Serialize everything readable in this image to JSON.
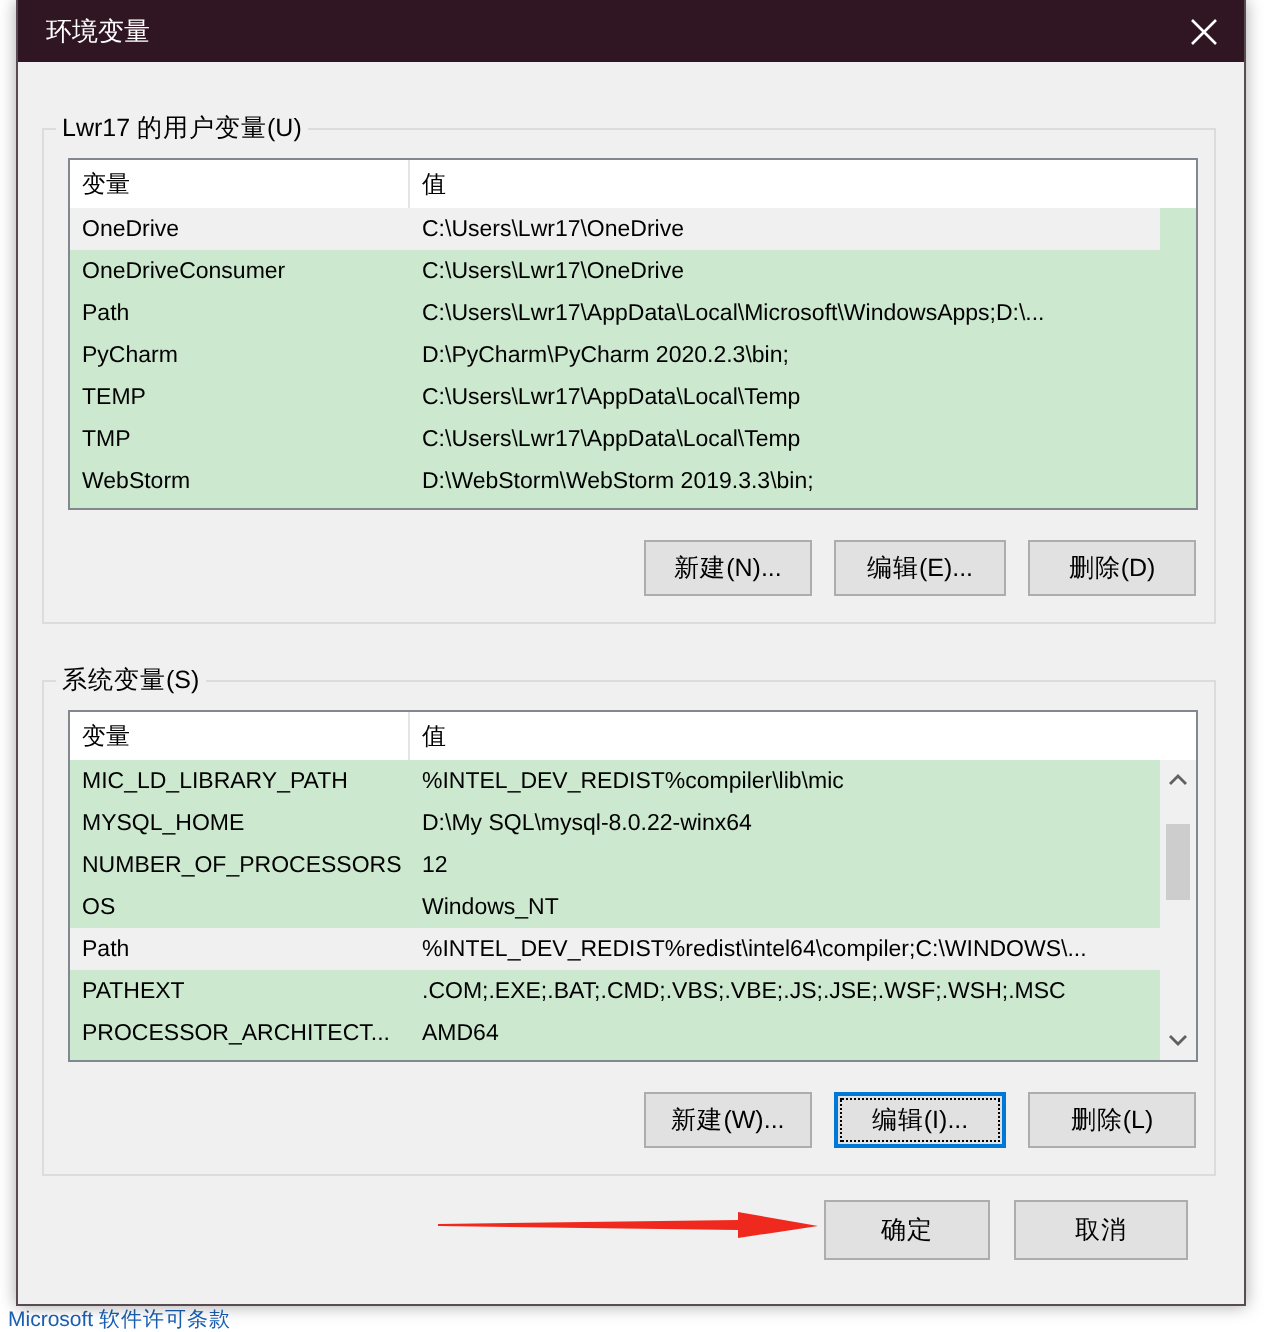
{
  "window": {
    "title": "环境变量"
  },
  "background": {
    "link": "Microsoft 软件许可条款"
  },
  "user_variables": {
    "title": "Lwr17 的用户变量(U)",
    "columns": [
      "变量",
      "值"
    ],
    "rows": [
      {
        "name": "OneDrive",
        "value": "C:\\Users\\Lwr17\\OneDrive",
        "selected": true
      },
      {
        "name": "OneDriveConsumer",
        "value": "C:\\Users\\Lwr17\\OneDrive",
        "selected": false
      },
      {
        "name": "Path",
        "value": "C:\\Users\\Lwr17\\AppData\\Local\\Microsoft\\WindowsApps;D:\\...",
        "selected": false
      },
      {
        "name": "PyCharm",
        "value": "D:\\PyCharm\\PyCharm 2020.2.3\\bin;",
        "selected": false
      },
      {
        "name": "TEMP",
        "value": "C:\\Users\\Lwr17\\AppData\\Local\\Temp",
        "selected": false
      },
      {
        "name": "TMP",
        "value": "C:\\Users\\Lwr17\\AppData\\Local\\Temp",
        "selected": false
      },
      {
        "name": "WebStorm",
        "value": "D:\\WebStorm\\WebStorm 2019.3.3\\bin;",
        "selected": false
      }
    ],
    "scrollbar": false,
    "buttons": [
      {
        "label": "新建(N)...",
        "focused": false
      },
      {
        "label": "编辑(E)...",
        "focused": false
      },
      {
        "label": "删除(D)",
        "focused": false
      }
    ]
  },
  "system_variables": {
    "title": "系统变量(S)",
    "columns": [
      "变量",
      "值"
    ],
    "rows": [
      {
        "name": "MIC_LD_LIBRARY_PATH",
        "value": "%INTEL_DEV_REDIST%compiler\\lib\\mic",
        "selected": false
      },
      {
        "name": "MYSQL_HOME",
        "value": "D:\\My SQL\\mysql-8.0.22-winx64",
        "selected": false
      },
      {
        "name": "NUMBER_OF_PROCESSORS",
        "value": "12",
        "selected": false
      },
      {
        "name": "OS",
        "value": "Windows_NT",
        "selected": false
      },
      {
        "name": "Path",
        "value": "%INTEL_DEV_REDIST%redist\\intel64\\compiler;C:\\WINDOWS\\...",
        "selected": true
      },
      {
        "name": "PATHEXT",
        "value": ".COM;.EXE;.BAT;.CMD;.VBS;.VBE;.JS;.JSE;.WSF;.WSH;.MSC",
        "selected": false
      },
      {
        "name": "PROCESSOR_ARCHITECT...",
        "value": "AMD64",
        "selected": false
      }
    ],
    "scrollbar": true,
    "buttons": [
      {
        "label": "新建(W)...",
        "focused": false
      },
      {
        "label": "编辑(I)...",
        "focused": true
      },
      {
        "label": "删除(L)",
        "focused": false
      }
    ]
  },
  "buttons": [
    {
      "label": "确定"
    },
    {
      "label": "取消"
    }
  ]
}
